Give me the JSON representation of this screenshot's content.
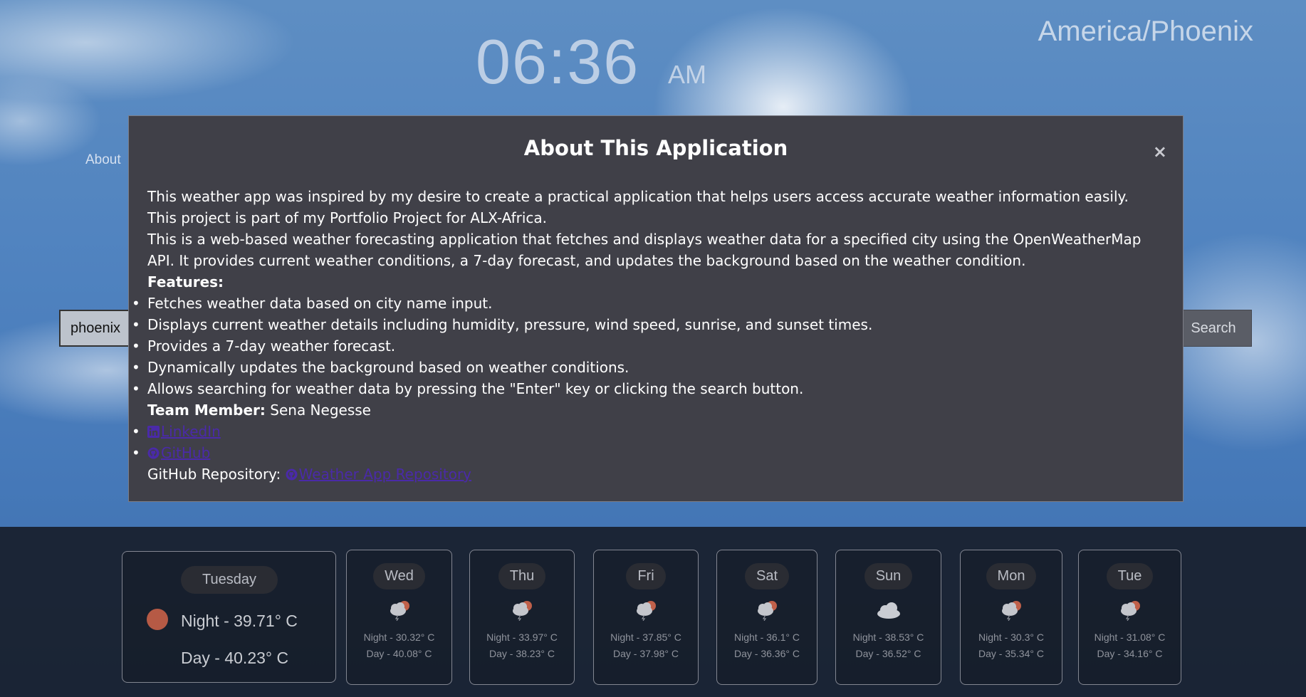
{
  "clock": {
    "time": "06:36",
    "ampm": "AM"
  },
  "timezone": "America/Phoenix",
  "nav": {
    "about_label": "About"
  },
  "search": {
    "value": "phoenix",
    "button_label": "Search"
  },
  "modal": {
    "title": "About This Application",
    "close_symbol": "×",
    "paragraph1": "This weather app was inspired by my desire to create a practical application that helps users access accurate weather information easily.",
    "paragraph2": "This project is part of my Portfolio Project for ALX-Africa.",
    "paragraph3": "This is a web-based weather forecasting application that fetches and displays weather data for a specified city using the OpenWeatherMap API. It provides current weather conditions, a 7-day forecast, and updates the background based on the weather condition.",
    "features_heading": "Features:",
    "features": [
      "Fetches weather data based on city name input.",
      "Displays current weather details including humidity, pressure, wind speed, sunrise, and sunset times.",
      "Provides a 7-day weather forecast.",
      "Dynamically updates the background based on weather conditions.",
      "Allows searching for weather data by pressing the \"Enter\" key or clicking the search button."
    ],
    "team_label": "Team Member:",
    "team_name": "Sena Negesse",
    "links": {
      "linkedin": "LinkedIn",
      "github": "GitHub"
    },
    "repo_label": "GitHub Repository:",
    "repo_link": "Weather App Repository"
  },
  "forecast": {
    "today": {
      "day": "Tuesday",
      "night": "Night - 39.71° C",
      "day_temp": "Day - 40.23° C",
      "icon": "sun-icon"
    },
    "days": [
      {
        "day": "Wed",
        "night": "Night - 30.32° C",
        "day_temp": "Day - 40.08° C",
        "icon": "thunderstorm-icon"
      },
      {
        "day": "Thu",
        "night": "Night - 33.97° C",
        "day_temp": "Day - 38.23° C",
        "icon": "thunderstorm-icon"
      },
      {
        "day": "Fri",
        "night": "Night - 37.85° C",
        "day_temp": "Day - 37.98° C",
        "icon": "thunderstorm-icon"
      },
      {
        "day": "Sat",
        "night": "Night - 36.1° C",
        "day_temp": "Day - 36.36° C",
        "icon": "thunderstorm-icon"
      },
      {
        "day": "Sun",
        "night": "Night - 38.53° C",
        "day_temp": "Day - 36.52° C",
        "icon": "cloud-icon"
      },
      {
        "day": "Mon",
        "night": "Night - 30.3° C",
        "day_temp": "Day - 35.34° C",
        "icon": "thunderstorm-icon"
      },
      {
        "day": "Tue",
        "night": "Night - 31.08° C",
        "day_temp": "Day - 34.16° C",
        "icon": "thunderstorm-icon"
      }
    ]
  },
  "colors": {
    "modal_bg": "#404048",
    "link": "#4a2aa8",
    "sun": "#b65a45"
  }
}
